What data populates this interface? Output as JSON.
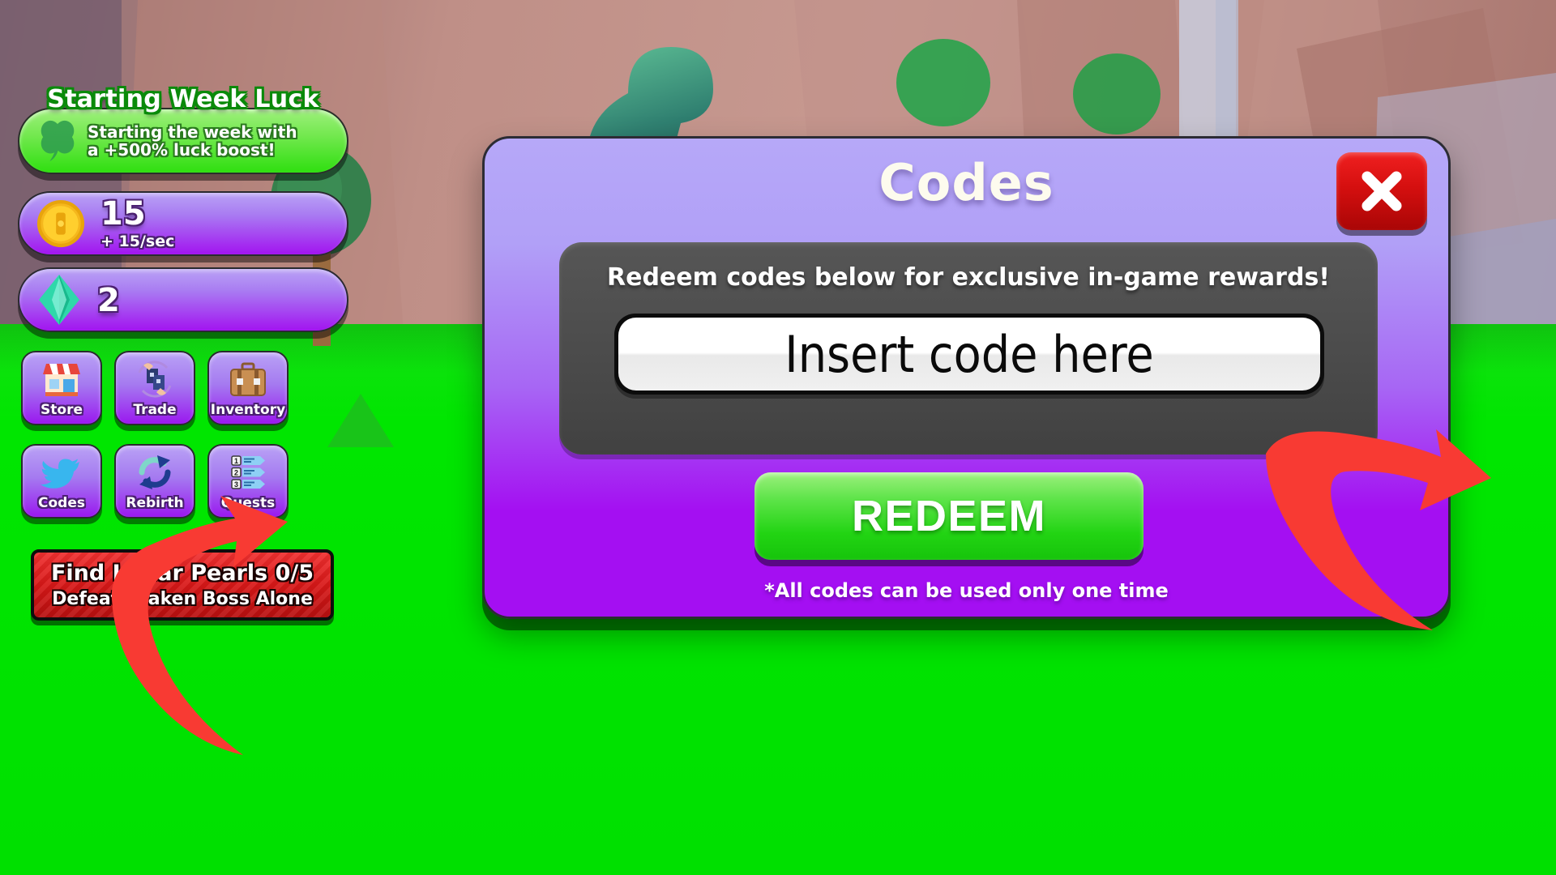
{
  "hud": {
    "luck_boost": {
      "title": "Starting Week Luck",
      "icon": "clover-icon",
      "line1": "Starting the week with",
      "line2": "a +500% luck boost!",
      "color": "#2fdf10"
    },
    "currencies": [
      {
        "name": "coins",
        "icon": "coin-icon",
        "value": "15",
        "rate": "+ 15/sec"
      },
      {
        "name": "gems",
        "icon": "gem-icon",
        "value": "2",
        "rate": ""
      }
    ],
    "menu_buttons": [
      {
        "label": "Store",
        "icon": "shop-icon"
      },
      {
        "label": "Trade",
        "icon": "trade-icon"
      },
      {
        "label": "Inventory",
        "icon": "briefcase-icon"
      },
      {
        "label": "Codes",
        "icon": "twitter-bird-icon"
      },
      {
        "label": "Rebirth",
        "icon": "rebirth-arrows-icon"
      },
      {
        "label": "Quests",
        "icon": "quest-list-icon"
      }
    ],
    "quest_banner": {
      "line1": "Find Lunar Pearls 0/5",
      "line2": "Defeat Kraken Boss Alone",
      "color": "#d81818"
    }
  },
  "modal": {
    "title": "Codes",
    "close_icon": "close-x-icon",
    "instruction": "Redeem codes below for exclusive in-game rewards!",
    "input_placeholder": "Insert code here",
    "input_value": "",
    "redeem_label": "REDEEM",
    "footer_note": "*All codes can be used only one time",
    "accent_color": "#a40ff2",
    "redeem_color": "#22d413",
    "close_color": "#d50f0f"
  },
  "annotations": {
    "arrow_color": "#f83a33",
    "arrow_left": "arrow-pointing-codes-button",
    "arrow_right": "arrow-pointing-code-input"
  }
}
